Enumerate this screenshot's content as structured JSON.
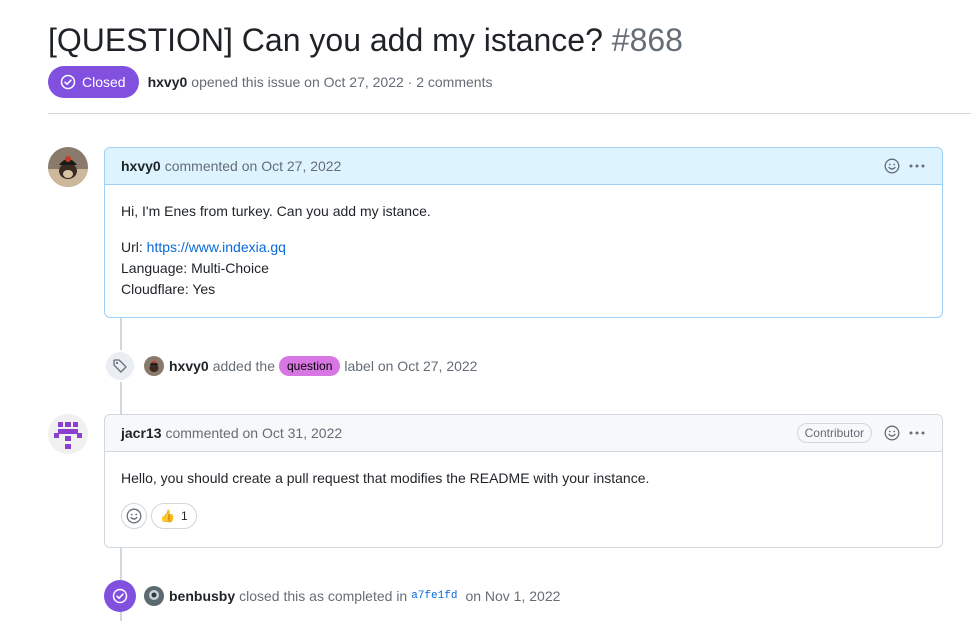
{
  "issue": {
    "title": "[QUESTION] Can you add my istance?",
    "number": "#868",
    "state": "Closed",
    "author": "hxvy0",
    "opened_text": "opened this issue on Oct 27, 2022 · 2 comments"
  },
  "comments": [
    {
      "author": "hxvy0",
      "meta": "commented on Oct 27, 2022",
      "body": {
        "intro": "Hi, I'm Enes from turkey. Can you add my istance.",
        "url_label": "Url:",
        "url": "https://www.indexia.gq",
        "language": "Language: Multi-Choice",
        "cloudflare": "Cloudflare: Yes"
      }
    },
    {
      "author": "jacr13",
      "meta": "commented on Oct 31, 2022",
      "role_badge": "Contributor",
      "body": "Hello, you should create a pull request that modifies the README with your instance.",
      "reactions": [
        {
          "emoji": "👍",
          "count": "1"
        }
      ]
    }
  ],
  "events": {
    "label": {
      "actor": "hxvy0",
      "pre": "added the",
      "label": "question",
      "post": "label on Oct 27, 2022",
      "label_color": "#d876e3"
    },
    "closed": {
      "actor": "benbusby",
      "pre": "closed this as completed in",
      "sha": "a7fe1fd",
      "post": "on Nov 1, 2022"
    }
  },
  "colors": {
    "closed": "#8250df",
    "link": "#0969da",
    "author_header": "#ddf4ff"
  },
  "icons": [
    "check-circle-icon",
    "smiley-icon",
    "kebab-icon",
    "tag-icon",
    "thumbs-up-icon"
  ]
}
